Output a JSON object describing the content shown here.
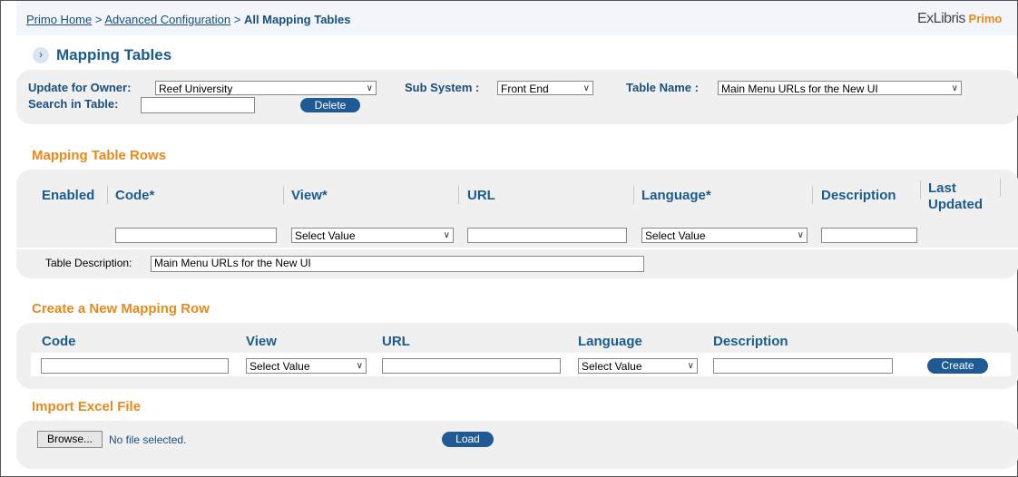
{
  "breadcrumb": {
    "home": "Primo Home",
    "sep1": " > ",
    "config": "Advanced Configuration",
    "sep2": " > ",
    "current": "All Mapping Tables"
  },
  "logo": {
    "ex": "ExLibris",
    "primo": "Primo"
  },
  "page_title": "Mapping Tables",
  "filters": {
    "owner_label": "Update for Owner:",
    "owner_value": "Reef University",
    "subsystem_label": "Sub System :",
    "subsystem_value": "Front End",
    "table_name_label": "Table Name :",
    "table_name_value": "Main Menu URLs for the New UI",
    "search_label": "Search in Table:",
    "search_value": "",
    "delete_label": "Delete"
  },
  "rows_section": {
    "title": "Mapping Table Rows",
    "columns": [
      "Enabled",
      "Code*",
      "View*",
      "URL",
      "Language*",
      "Description",
      "Last Updated"
    ],
    "view_filter": "Select Value",
    "language_filter": "Select Value",
    "table_desc_label": "Table Description:",
    "table_desc_value": "Main Menu URLs for the New UI"
  },
  "create_section": {
    "title": "Create a New Mapping Row",
    "columns": [
      "Code",
      "View",
      "URL",
      "Language",
      "Description"
    ],
    "view_value": "Select Value",
    "language_value": "Select Value",
    "create_label": "Create"
  },
  "import_section": {
    "title": "Import Excel File",
    "browse_label": "Browse...",
    "file_status": "No file selected.",
    "load_label": "Load"
  },
  "colors": {
    "accent_blue": "#1a5c8c",
    "section_orange": "#e8891c",
    "button_blue": "#1f5a94"
  }
}
